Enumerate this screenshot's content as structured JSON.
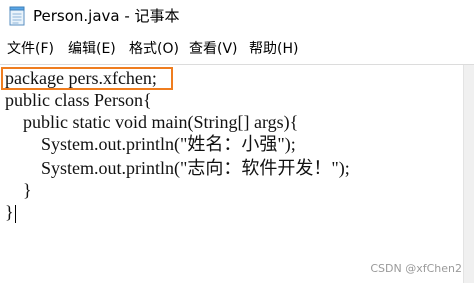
{
  "window": {
    "title": "Person.java - 记事本",
    "icon": "notepad-icon"
  },
  "menu": {
    "file": "文件(F)",
    "edit": "编辑(E)",
    "format": "格式(O)",
    "view": "查看(V)",
    "help": "帮助(H)"
  },
  "editor": {
    "lines": [
      "package pers.xfchen;",
      "public class Person{",
      "    public static void main(String[] args){",
      "        System.out.println(\"姓名：小强\");",
      "        System.out.println(\"志向：软件开发！\");",
      "    }",
      "}"
    ]
  },
  "annotation": {
    "highlight_color": "#ef7d1f"
  },
  "watermark": "CSDN @xfChen2"
}
